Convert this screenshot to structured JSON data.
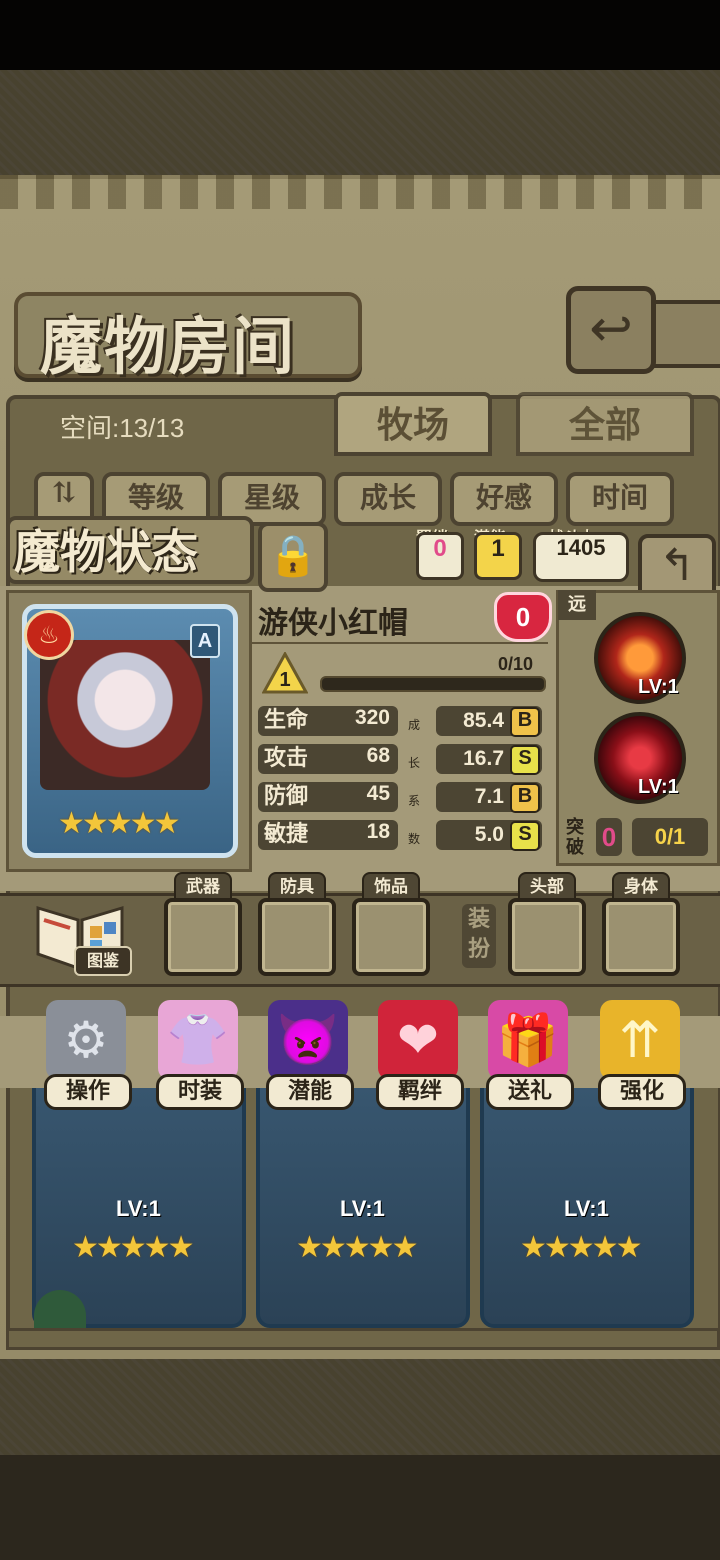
{
  "screen": {
    "title": "魔物房间",
    "space_label": "空间:13/13",
    "tabs": [
      "牧场",
      "全部"
    ],
    "filters": [
      "等级",
      "星级",
      "成长",
      "好感",
      "时间"
    ],
    "back_icon": "return-icon"
  },
  "status": {
    "title": "魔物状态",
    "bond_label": "羁绊",
    "bond_value": "0",
    "potential_label": "潜能",
    "potential_value": "1",
    "power_label": "战斗力",
    "power_value": "1405"
  },
  "monster": {
    "name": "游侠小红帽",
    "affection": "0",
    "rank": "A",
    "element": "fire",
    "stars": 5,
    "level": "1",
    "exp_text": "0/10",
    "exp_fraction": 0.0,
    "stats": [
      {
        "name": "生命",
        "value": "320",
        "growth": "85.4",
        "grade": "B"
      },
      {
        "name": "攻击",
        "value": "68",
        "growth": "16.7",
        "grade": "S"
      },
      {
        "name": "防御",
        "value": "45",
        "growth": "7.1",
        "grade": "B"
      },
      {
        "name": "敏捷",
        "value": "18",
        "growth": "5.0",
        "grade": "S"
      }
    ],
    "growth_label": [
      "成",
      "长",
      "系",
      "数"
    ],
    "range": "远",
    "skills": [
      {
        "name": "arrow-volley-skill",
        "level": "LV:1"
      },
      {
        "name": "crimson-mist-skill",
        "level": "LV:1"
      }
    ],
    "breakthrough_label": "突破",
    "breakthrough_value": "0",
    "breakthrough_count": "0/1"
  },
  "equipment": {
    "slots": [
      "武器",
      "防具",
      "饰品",
      "头部",
      "身体"
    ],
    "dress_label": "装扮",
    "book_label": "图鉴"
  },
  "actions": [
    "操作",
    "时装",
    "潜能",
    "羁绊",
    "送礼",
    "强化"
  ],
  "tiles": [
    {
      "level": "LV:1",
      "stars": 5
    },
    {
      "level": "LV:1",
      "stars": 5
    },
    {
      "level": "LV:1",
      "stars": 5
    }
  ],
  "colors": {
    "panel": "#a49a79",
    "dark_border": "#4c4331",
    "grade_B": "#f0c24a",
    "grade_S": "#e8e14a",
    "pink_value": "#e14b8a"
  }
}
